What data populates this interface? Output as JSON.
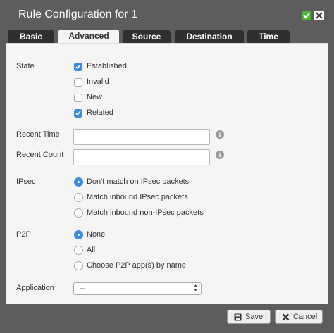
{
  "window": {
    "title": "Rule Configuration for 1"
  },
  "tabs": [
    {
      "label": "Basic"
    },
    {
      "label": "Advanced"
    },
    {
      "label": "Source"
    },
    {
      "label": "Destination"
    },
    {
      "label": "Time"
    }
  ],
  "state": {
    "label": "State",
    "options": [
      {
        "label": "Established",
        "checked": true
      },
      {
        "label": "Invalid",
        "checked": false
      },
      {
        "label": "New",
        "checked": false
      },
      {
        "label": "Related",
        "checked": true
      }
    ]
  },
  "recent_time": {
    "label": "Recent Time",
    "value": ""
  },
  "recent_count": {
    "label": "Recent Count",
    "value": ""
  },
  "ipsec": {
    "label": "IPsec",
    "options": [
      {
        "label": "Don't match on IPsec packets",
        "selected": true
      },
      {
        "label": "Match inbound IPsec packets",
        "selected": false
      },
      {
        "label": "Match inbound non-IPsec packets",
        "selected": false
      }
    ]
  },
  "p2p": {
    "label": "P2P",
    "options": [
      {
        "label": "None",
        "selected": true
      },
      {
        "label": "All",
        "selected": false
      },
      {
        "label": "Choose P2P app(s) by name",
        "selected": false
      }
    ]
  },
  "application": {
    "label": "Application",
    "selected": "--"
  },
  "footer": {
    "save_label": "Save",
    "cancel_label": "Cancel"
  },
  "colors": {
    "accent": "#3c8be3",
    "titlebar": "#5d5d5d",
    "ok": "#4db33d"
  }
}
